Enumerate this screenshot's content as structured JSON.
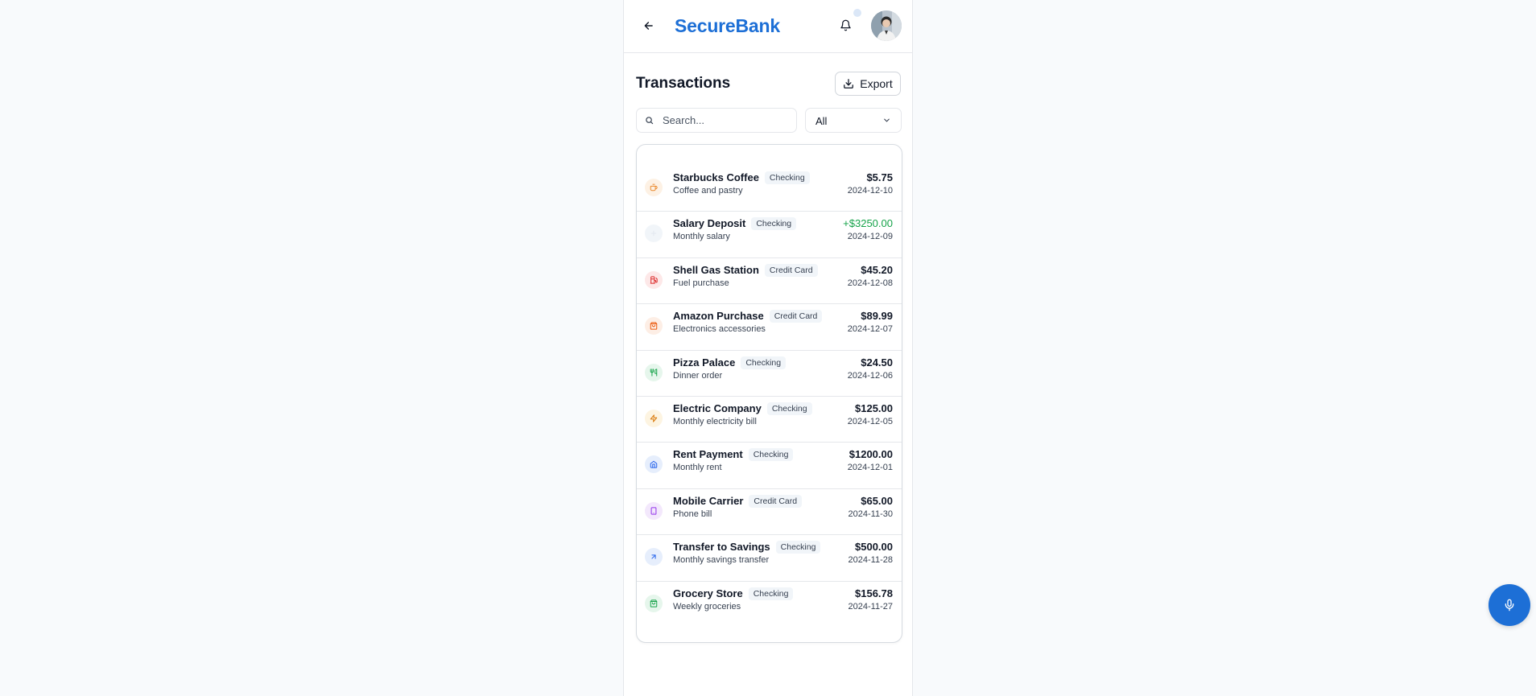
{
  "header": {
    "brand": "SecureBank",
    "back_icon": "arrow-left-icon",
    "bell_icon": "bell-icon"
  },
  "page": {
    "title": "Transactions",
    "export_label": "Export",
    "export_icon": "download-icon"
  },
  "search": {
    "value": "",
    "placeholder": "Search..."
  },
  "filter": {
    "selected": "All"
  },
  "colors": {
    "brand": "#1d6fd6",
    "credit": "#16a34a"
  },
  "transactions": [
    {
      "name": "Starbucks Coffee",
      "account": "Checking",
      "description": "Coffee and pastry",
      "amount": "$5.75",
      "date": "2024-12-10",
      "icon": "coffee-icon",
      "icon_color": "#ea8a2f",
      "icon_bg": "#fdf1e4"
    },
    {
      "name": "Salary Deposit",
      "account": "Checking",
      "description": "Monthly salary",
      "amount": "+$3250.00",
      "date": "2024-12-09",
      "icon": "deposit-icon",
      "icon_color": "#e2e8f0",
      "icon_bg": "#f1f5f9",
      "credit": true
    },
    {
      "name": "Shell Gas Station",
      "account": "Credit Card",
      "description": "Fuel purchase",
      "amount": "$45.20",
      "date": "2024-12-08",
      "icon": "fuel-icon",
      "icon_color": "#dc2626",
      "icon_bg": "#fde8e8"
    },
    {
      "name": "Amazon Purchase",
      "account": "Credit Card",
      "description": "Electronics accessories",
      "amount": "$89.99",
      "date": "2024-12-07",
      "icon": "shopping-bag-icon",
      "icon_color": "#ea580c",
      "icon_bg": "#fdeee5"
    },
    {
      "name": "Pizza Palace",
      "account": "Checking",
      "description": "Dinner order",
      "amount": "$24.50",
      "date": "2024-12-06",
      "icon": "utensils-icon",
      "icon_color": "#16a34a",
      "icon_bg": "#e6f6ec"
    },
    {
      "name": "Electric Company",
      "account": "Checking",
      "description": "Monthly electricity bill",
      "amount": "$125.00",
      "date": "2024-12-05",
      "icon": "lightning-icon",
      "icon_color": "#d97706",
      "icon_bg": "#fdf4e1"
    },
    {
      "name": "Rent Payment",
      "account": "Checking",
      "description": "Monthly rent",
      "amount": "$1200.00",
      "date": "2024-12-01",
      "icon": "home-icon",
      "icon_color": "#2563eb",
      "icon_bg": "#e6eefc"
    },
    {
      "name": "Mobile Carrier",
      "account": "Credit Card",
      "description": "Phone bill",
      "amount": "$65.00",
      "date": "2024-11-30",
      "icon": "phone-icon",
      "icon_color": "#9333ea",
      "icon_bg": "#f3e8fc"
    },
    {
      "name": "Transfer to Savings",
      "account": "Checking",
      "description": "Monthly savings transfer",
      "amount": "$500.00",
      "date": "2024-11-28",
      "icon": "arrow-up-right-icon",
      "icon_color": "#2563eb",
      "icon_bg": "#e6eefc"
    },
    {
      "name": "Grocery Store",
      "account": "Checking",
      "description": "Weekly groceries",
      "amount": "$156.78",
      "date": "2024-11-27",
      "icon": "basket-icon",
      "icon_color": "#16a34a",
      "icon_bg": "#e6f6ec"
    }
  ],
  "fab": {
    "icon": "microphone-icon"
  }
}
